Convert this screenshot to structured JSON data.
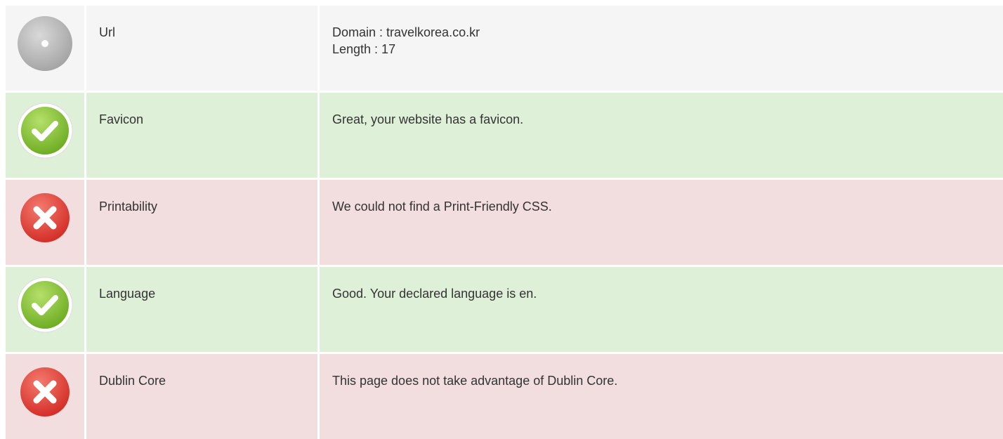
{
  "colors": {
    "neutral_bg": "#f5f5f5",
    "pass_bg": "#dff0d8",
    "fail_bg": "#f2dede",
    "pass_icon": "#8cc63f",
    "fail_icon": "#e8413b",
    "neutral_icon": "#b3b3b3"
  },
  "rows": [
    {
      "status": "neutral",
      "icon": "info-disc-icon",
      "label": "Url",
      "lines": [
        "Domain : travelkorea.co.kr",
        "Length : 17"
      ]
    },
    {
      "status": "pass",
      "icon": "check-circle-icon",
      "label": "Favicon",
      "lines": [
        "Great, your website has a favicon."
      ]
    },
    {
      "status": "fail",
      "icon": "x-circle-icon",
      "label": "Printability",
      "lines": [
        "We could not find a Print-Friendly CSS."
      ]
    },
    {
      "status": "pass",
      "icon": "check-circle-icon",
      "label": "Language",
      "lines": [
        "Good. Your declared language is en."
      ]
    },
    {
      "status": "fail",
      "icon": "x-circle-icon",
      "label": "Dublin Core",
      "lines": [
        "This page does not take advantage of Dublin Core."
      ]
    }
  ]
}
